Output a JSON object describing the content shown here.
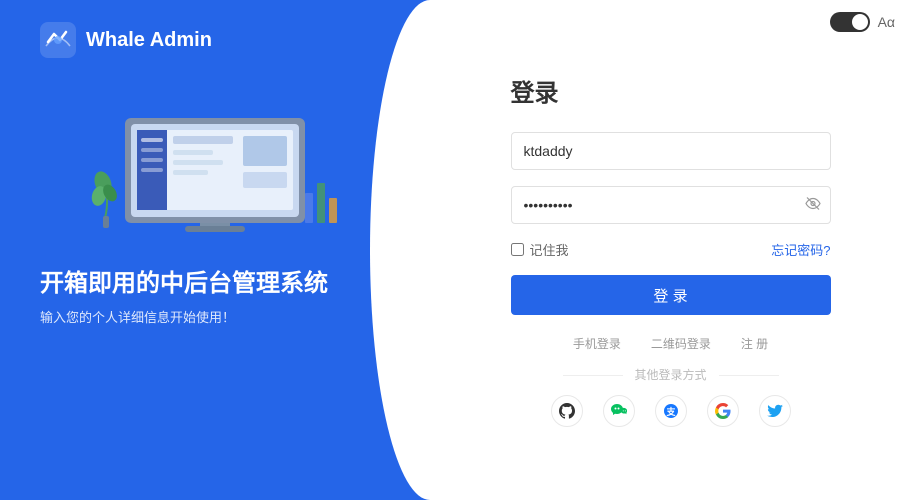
{
  "app": {
    "title": "Whale Admin"
  },
  "left": {
    "tagline_main": "开箱即用的中后台管理系统",
    "tagline_sub": "输入您的个人详细信息开始使用！"
  },
  "form": {
    "title": "登录",
    "username_placeholder": "ktdaddy",
    "username_value": "ktdaddy",
    "password_value": "••••••••••",
    "remember_label": "记住我",
    "forgot_label": "忘记密码?",
    "login_button": "登 录",
    "alt_methods": [
      "手机登录",
      "二维码登录",
      "注 册"
    ],
    "other_label": "其他登录方式",
    "social": [
      "github",
      "wechat",
      "alipay",
      "google",
      "twitter"
    ]
  },
  "controls": {
    "darkmode_toggle": "dark-mode",
    "language": "Aα"
  }
}
